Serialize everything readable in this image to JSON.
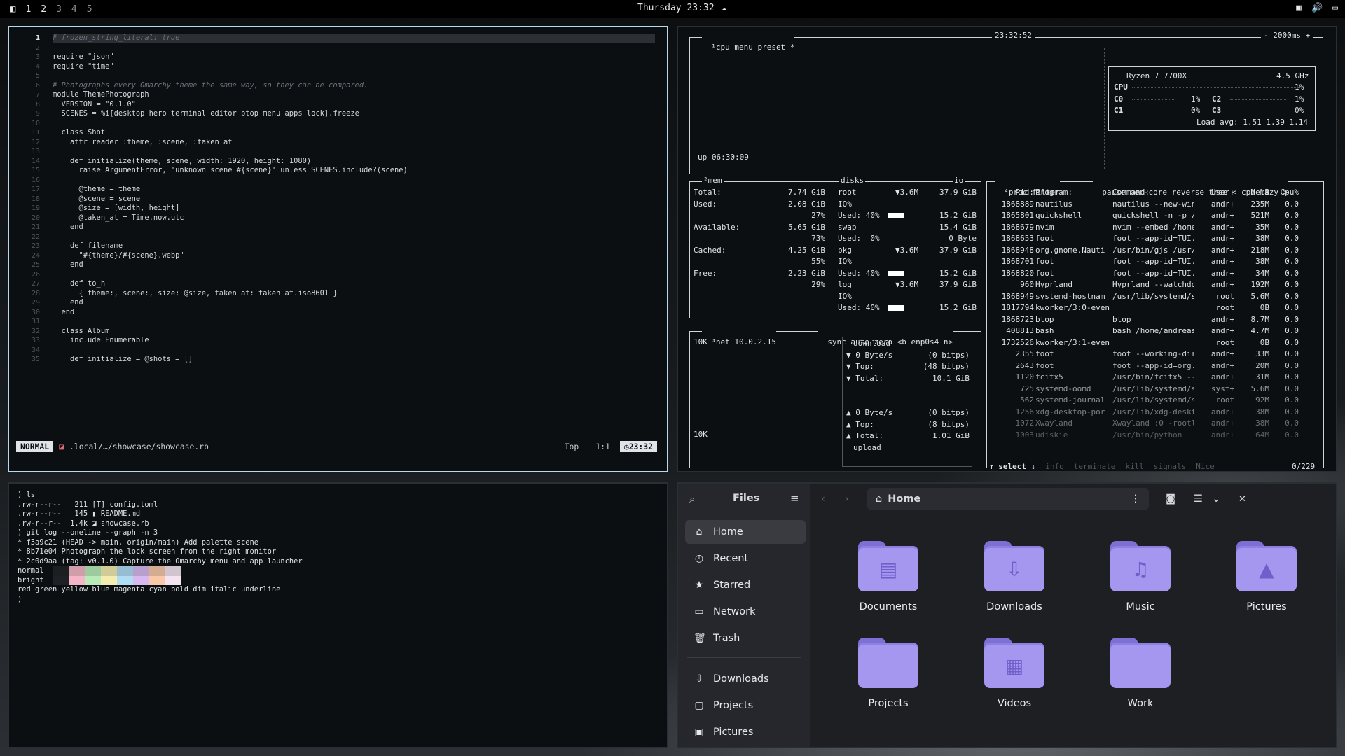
{
  "topbar": {
    "workspaces": [
      "1",
      "2",
      "3",
      "4",
      "5"
    ],
    "clock": "Thursday 23:32"
  },
  "editor": {
    "lines": [
      "# frozen_string_literal: true",
      "",
      "require \"json\"",
      "require \"time\"",
      "",
      "# Photographs every Omarchy theme the same way, so they can be compared.",
      "module ThemePhotograph",
      "  VERSION = \"0.1.0\"",
      "  SCENES = %i[desktop hero terminal editor btop menu apps lock].freeze",
      "",
      "  class Shot",
      "    attr_reader :theme, :scene, :taken_at",
      "",
      "    def initialize(theme, scene, width: 1920, height: 1080)",
      "      raise ArgumentError, \"unknown scene #{scene}\" unless SCENES.include?(scene)",
      "",
      "      @theme = theme",
      "      @scene = scene",
      "      @size = [width, height]",
      "      @taken_at = Time.now.utc",
      "    end",
      "",
      "    def filename",
      "      \"#{theme}/#{scene}.webp\"",
      "    end",
      "",
      "    def to_h",
      "      { theme:, scene:, size: @size, taken_at: taken_at.iso8601 }",
      "    end",
      "  end",
      "",
      "  class Album",
      "    include Enumerable",
      "",
      "    def initialize = @shots = []"
    ],
    "numbers": [
      "1",
      "2",
      "3",
      "4",
      "5",
      "6",
      "7",
      "8",
      "9",
      "10",
      "11",
      "12",
      "13",
      "14",
      "15",
      "16",
      "17",
      "18",
      "19",
      "20",
      "21",
      "22",
      "23",
      "24",
      "25",
      "26",
      "27",
      "28",
      "29",
      "30",
      "31",
      "32",
      "33",
      "34",
      "35"
    ],
    "mode": "NORMAL",
    "path": ".local/…/showcase/showcase.rb",
    "pos": "Top",
    "cursor": "1:1",
    "time": "23:32"
  },
  "btop": {
    "header": {
      "cpu": "¹cpu",
      "menu": "menu",
      "preset": "preset *",
      "time": "23:32:52",
      "rate": "- 2000ms +"
    },
    "cpu": {
      "model": "Ryzen 7 7700X",
      "freq": "4.5 GHz",
      "rows": [
        "CPU",
        "C0",
        "C1"
      ],
      "rows_b": [
        "C2",
        "C3"
      ],
      "vals": [
        "1%",
        "1%",
        "0%"
      ],
      "vals_b": [
        "1%",
        "0%"
      ],
      "load": "Load avg: 1.51 1.39 1.14",
      "uptime": "up 06:30:09"
    },
    "mem": {
      "title": "²mem",
      "lines": [
        "Total:",
        "Used:",
        "",
        "Available:",
        "",
        "Cached:",
        "",
        "Free:",
        ""
      ],
      "vals": [
        "7.74 GiB",
        "2.08 GiB",
        "27%",
        "5.65 GiB",
        "73%",
        "4.25 GiB",
        "55%",
        "2.23 GiB",
        "29%"
      ]
    },
    "disks": {
      "title": "disks",
      "io": "io",
      "rows": [
        [
          "root",
          "▼3.6M",
          "37.9 GiB"
        ],
        [
          "IO%",
          "",
          ""
        ],
        [
          "Used: 40%",
          "",
          "15.2 GiB"
        ],
        [
          "swap",
          "",
          "15.4 GiB"
        ],
        [
          "Used:  0%",
          "",
          "0 Byte"
        ],
        [
          "pkg",
          "▼3.6M",
          "37.9 GiB"
        ],
        [
          "IO%",
          "",
          ""
        ],
        [
          "Used: 40%",
          "",
          "15.2 GiB"
        ],
        [
          "log",
          "▼3.6M",
          "37.9 GiB"
        ],
        [
          "IO%",
          "",
          ""
        ],
        [
          "Used: 40%",
          "",
          "15.2 GiB"
        ]
      ]
    },
    "net": {
      "title": "³net",
      "ip": "10.0.2.15",
      "sync": "sync",
      "auto": "auto",
      "zero": "zero",
      "iface": "<b enp0s4 n>",
      "scale_top": "10K",
      "scale_bot": "10K",
      "down": [
        "download",
        "▼ 0 Byte/s",
        "▼ Top:",
        "▼ Total:"
      ],
      "down_v": [
        "",
        "(0 bitps)",
        "(48 bitps)",
        "10.1 GiB"
      ],
      "up": [
        "▲ 0 Byte/s",
        "▲ Top:",
        "▲ Total:",
        "upload"
      ],
      "up_v": [
        "(0 bitps)",
        "(8 bitps)",
        "1.01 GiB",
        ""
      ]
    },
    "proc": {
      "title": "⁴proc",
      "filter": "filter",
      "pause": "pause",
      "percore": "per-core",
      "reverse": "reverse",
      "tree": "tree",
      "sort": "< cpu lazy >",
      "cols": [
        "Pid:",
        "Program:",
        "Command:",
        "User:",
        "MemB",
        "Cpu%"
      ],
      "rows": [
        [
          "1868889",
          "nautilus",
          "nautilus --new-win",
          "andr+",
          "235M",
          "0.0"
        ],
        [
          "1865801",
          "quickshell",
          "quickshell -n -p /",
          "andr+",
          "521M",
          "0.0"
        ],
        [
          "1868679",
          "nvim",
          "nvim --embed /home",
          "andr+",
          "35M",
          "0.0"
        ],
        [
          "1868653",
          "foot",
          "foot --app-id=TUI.",
          "andr+",
          "38M",
          "0.0"
        ],
        [
          "1868948",
          "org.gnome.Nauti",
          "/usr/bin/gjs /usr/",
          "andr+",
          "218M",
          "0.0"
        ],
        [
          "1868701",
          "foot",
          "foot --app-id=TUI.",
          "andr+",
          "38M",
          "0.0"
        ],
        [
          "1868820",
          "foot",
          "foot --app-id=TUI.",
          "andr+",
          "34M",
          "0.0"
        ],
        [
          "960",
          "Hyprland",
          "Hyprland --watchdo",
          "andr+",
          "192M",
          "0.0"
        ],
        [
          "1868949",
          "systemd-hostnam",
          "/usr/lib/systemd/s",
          "root",
          "5.6M",
          "0.0"
        ],
        [
          "1817794",
          "kworker/3:0-even",
          "",
          "root",
          "0B",
          "0.0"
        ],
        [
          "1868723",
          "btop",
          "btop",
          "andr+",
          "8.7M",
          "0.0"
        ],
        [
          "408813",
          "bash",
          "bash /home/andreas",
          "andr+",
          "4.7M",
          "0.0"
        ],
        [
          "1732526",
          "kworker/3:1-even",
          "",
          "root",
          "0B",
          "0.0"
        ],
        [
          "2355",
          "foot",
          "foot --working-dir",
          "andr+",
          "33M",
          "0.0"
        ],
        [
          "2643",
          "foot",
          "foot --app-id=org.",
          "andr+",
          "20M",
          "0.0"
        ],
        [
          "1120",
          "fcitx5",
          "/usr/bin/fcitx5 --",
          "andr+",
          "31M",
          "0.0"
        ],
        [
          "725",
          "systemd-oomd",
          "/usr/lib/systemd/s",
          "syst+",
          "5.6M",
          "0.0"
        ],
        [
          "562",
          "systemd-journal",
          "/usr/lib/systemd/s",
          "root",
          "92M",
          "0.0"
        ],
        [
          "1256",
          "xdg-desktop-por",
          "/usr/lib/xdg-deskt",
          "andr+",
          "38M",
          "0.0"
        ],
        [
          "1072",
          "Xwayland",
          "Xwayland :0 -rootl",
          "andr+",
          "38M",
          "0.0"
        ],
        [
          "1003",
          "udiskie",
          "/usr/bin/python",
          "andr+",
          "64M",
          "0.0"
        ]
      ],
      "footer": [
        "↑ select ↓",
        "info",
        "terminate",
        "kill",
        "signals",
        "Nice"
      ],
      "count": "0/229"
    }
  },
  "shell": {
    "lines": [
      ") ls",
      ".rw-r--r--   211 [T] config.toml",
      ".rw-r--r--   145 ▮ README.md",
      ".rw-r--r--  1.4k ◪ showcase.rb",
      ") git log --oneline --graph -n 3",
      "* f3a9c21 (HEAD -> main, origin/main) Add palette scene",
      "* 8b71e04 Photograph the lock screen from the right monitor",
      "* 2c0d9aa (tag: v0.1.0) Capture the Omarchy menu and app launcher",
      "normal",
      "bright",
      "red green yellow blue magenta cyan bold dim italic underline",
      ")"
    ],
    "palette": [
      "#1e2226",
      "#f4b6c6",
      "#b8ebb8",
      "#f4ecb0",
      "#b0dcf4",
      "#d8b8f0",
      "#f8c8a8",
      "#f4e4f0"
    ]
  },
  "files": {
    "title": "Files",
    "location": "Home",
    "sidebar": [
      {
        "icon": "⌂",
        "label": "Home"
      },
      {
        "icon": "◷",
        "label": "Recent"
      },
      {
        "icon": "★",
        "label": "Starred"
      },
      {
        "icon": "▭",
        "label": "Network"
      },
      {
        "icon": "🗑",
        "label": "Trash"
      },
      {
        "icon": "⇩",
        "label": "Downloads"
      },
      {
        "icon": "▢",
        "label": "Projects"
      },
      {
        "icon": "▣",
        "label": "Pictures"
      }
    ],
    "folders": [
      {
        "label": "Documents",
        "glyph": "▤"
      },
      {
        "label": "Downloads",
        "glyph": "⇩"
      },
      {
        "label": "Music",
        "glyph": "♫"
      },
      {
        "label": "Pictures",
        "glyph": "▲"
      },
      {
        "label": "Projects",
        "glyph": ""
      },
      {
        "label": "Videos",
        "glyph": "▦"
      },
      {
        "label": "Work",
        "glyph": ""
      }
    ]
  }
}
